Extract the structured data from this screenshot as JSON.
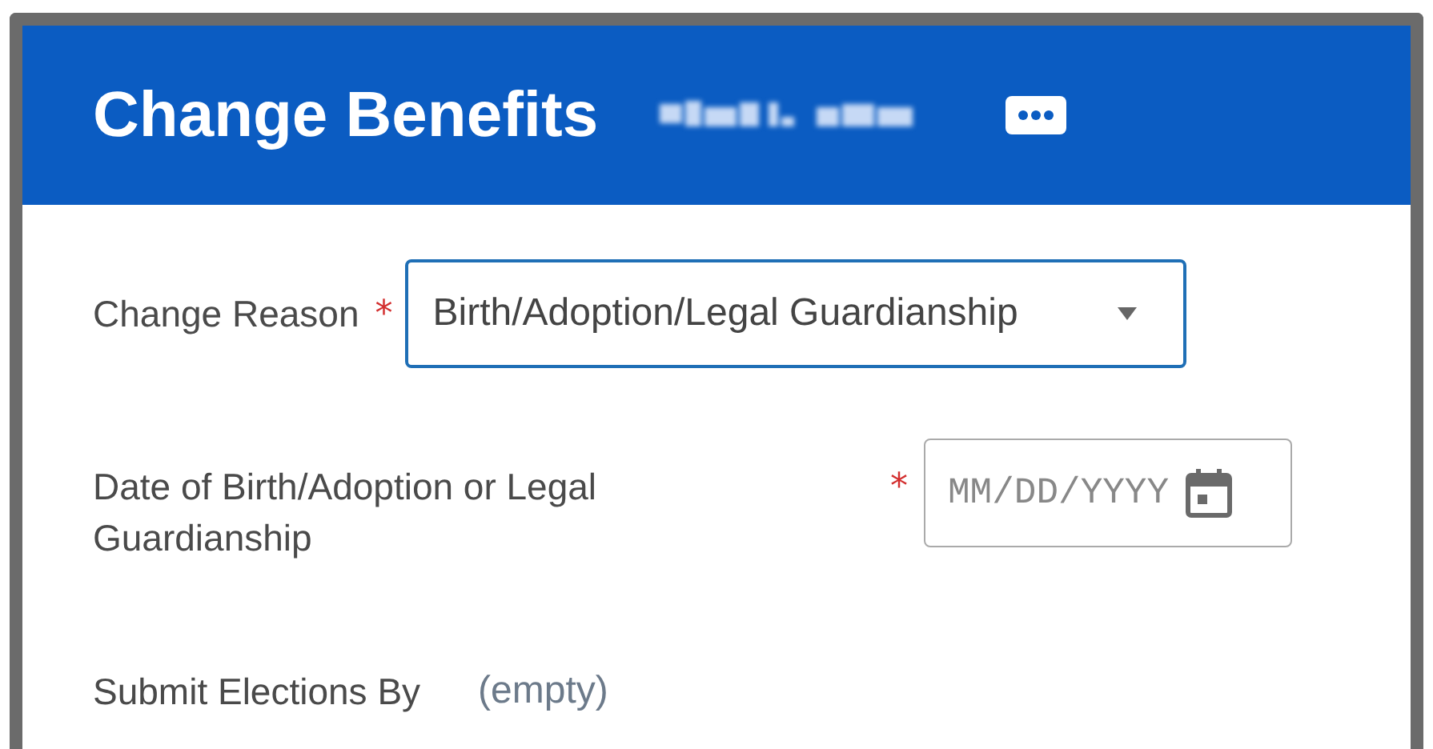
{
  "header": {
    "title": "Change Benefits",
    "name_redacted": true
  },
  "fields": [
    {
      "kind": "select",
      "label": "Change Reason",
      "required_mark": "*",
      "value": "Birth/Adoption/Legal Guardianship",
      "focused": true
    },
    {
      "kind": "date",
      "label": "Date of Birth/Adoption or Legal Guardianship",
      "required_mark": "*",
      "placeholder": "MM/DD/YYYY",
      "focused": false
    },
    {
      "kind": "readonly",
      "label": "Submit Elections By",
      "value": "(empty)"
    }
  ]
}
